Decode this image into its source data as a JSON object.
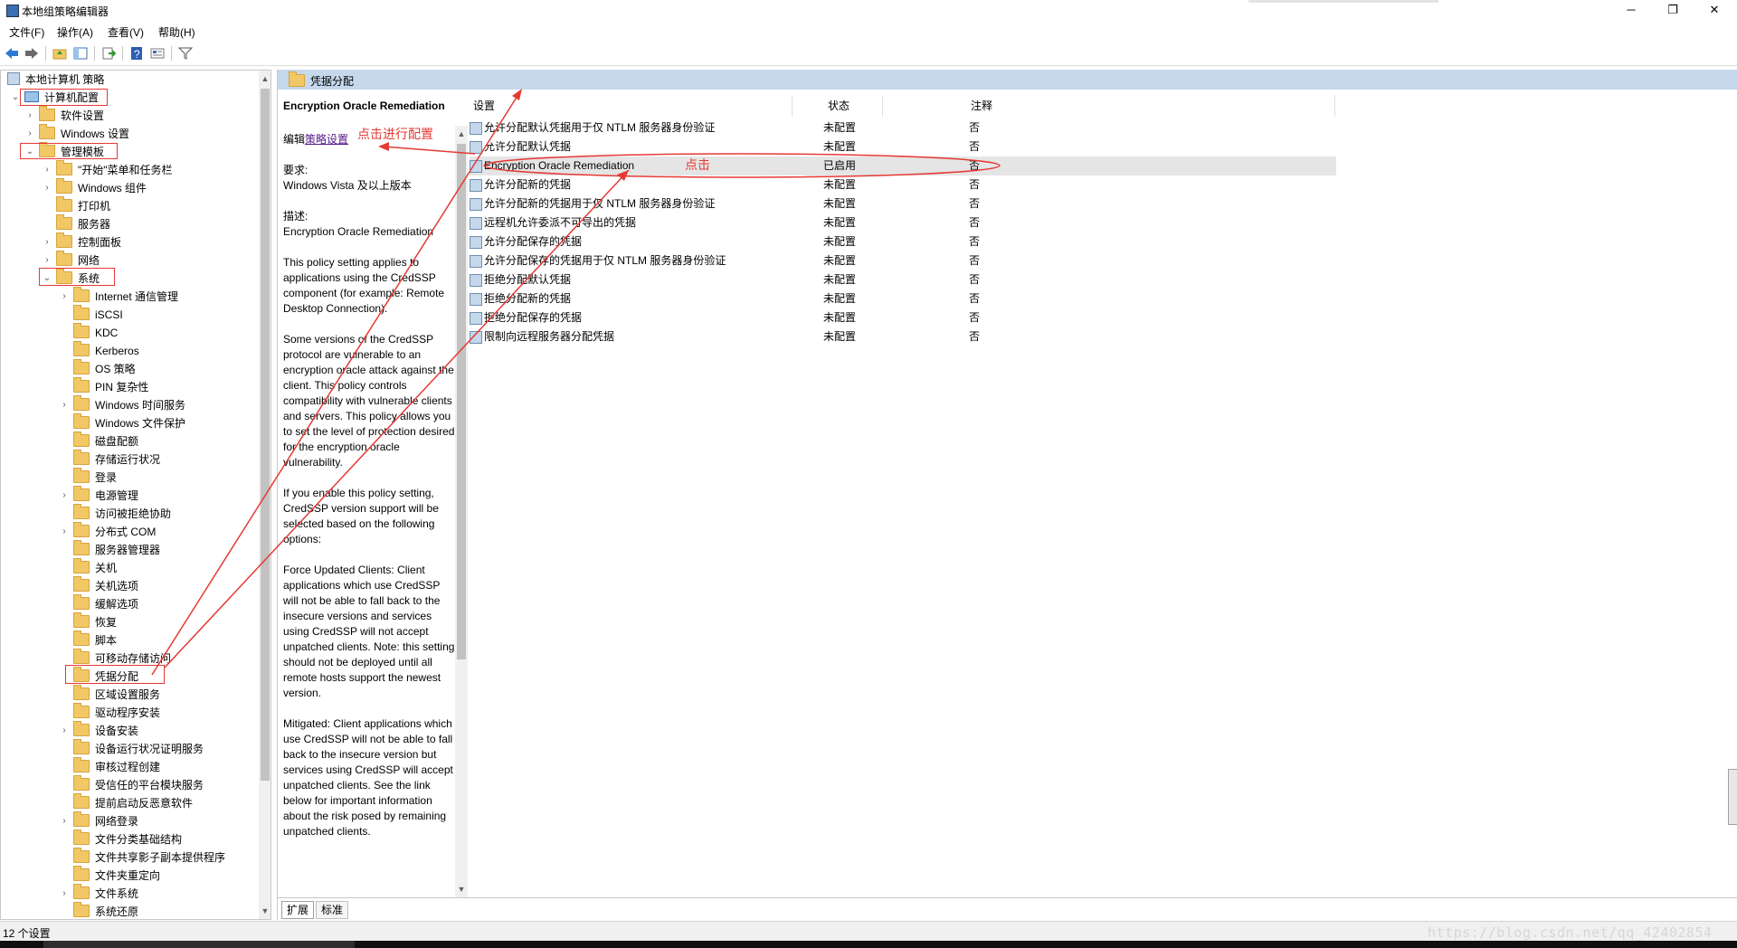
{
  "window": {
    "title": "本地组策略编辑器",
    "controls": {
      "minimize": "─",
      "maximize": "❐",
      "close": "✕"
    }
  },
  "menu": [
    "文件(F)",
    "操作(A)",
    "查看(V)",
    "帮助(H)"
  ],
  "toolbar": {
    "icons": [
      "back-arrow-icon",
      "forward-arrow-icon",
      "up-folder-icon",
      "show-hide-tree-icon",
      "export-list-icon",
      "help-icon",
      "properties-icon",
      "filter-icon"
    ]
  },
  "tree": {
    "root": "本地计算机 策略",
    "computer_config": "计算机配置",
    "software_settings": "软件设置",
    "windows_settings": "Windows 设置",
    "admin_templates": "管理模板",
    "start_menu": "\"开始\"菜单和任务栏",
    "windows_components": "Windows 组件",
    "printers": "打印机",
    "servers": "服务器",
    "control_panel": "控制面板",
    "network": "网络",
    "system": "系统",
    "system_children": [
      "Internet 通信管理",
      "iSCSI",
      "KDC",
      "Kerberos",
      "OS 策略",
      "PIN 复杂性",
      "Windows 时间服务",
      "Windows 文件保护",
      "磁盘配额",
      "存储运行状况",
      "登录",
      "电源管理",
      "访问被拒绝协助",
      "分布式 COM",
      "服务器管理器",
      "关机",
      "关机选项",
      "缓解选项",
      "恢复",
      "脚本",
      "可移动存储访问",
      "凭据分配",
      "区域设置服务",
      "驱动程序安装",
      "设备安装",
      "设备运行状况证明服务",
      "审核过程创建",
      "受信任的平台模块服务",
      "提前启动反恶意软件",
      "网络登录",
      "文件分类基础结构",
      "文件共享影子副本提供程序",
      "文件夹重定向",
      "文件系统",
      "系统还原"
    ]
  },
  "right": {
    "folder_title": "凭据分配",
    "description": {
      "title": "Encryption Oracle Remediation",
      "edit_prefix": "编辑",
      "edit_link": "策略设置",
      "requirements_label": "要求:",
      "requirements": "Windows Vista 及以上版本",
      "desc_label": "描述:",
      "desc_name": "Encryption Oracle Remediation",
      "p1": "This policy setting applies to applications using the CredSSP component (for example: Remote Desktop Connection).",
      "p2": "Some versions of the CredSSP protocol are vulnerable to an encryption oracle attack against the client.  This policy controls compatibility with vulnerable clients and servers. This policy allows you to set the level of protection desired for the encryption oracle vulnerability.",
      "p3": "If you enable this policy setting, CredSSP version support will be selected based on the following options:",
      "p4": "Force Updated Clients: Client applications which use CredSSP will not be able to fall back to the insecure versions and services using CredSSP will not accept unpatched clients. Note: this setting should not be deployed until all remote hosts support the newest version.",
      "p5": "Mitigated: Client applications which use CredSSP will not be able to fall back to the insecure version but services using CredSSP will accept unpatched clients. See the link below for important information about the risk posed by remaining unpatched clients."
    },
    "columns": {
      "setting": "设置",
      "state": "状态",
      "comment": "注释"
    },
    "rows": [
      {
        "name": "允许分配默认凭据用于仅 NTLM 服务器身份验证",
        "state": "未配置",
        "comment": "否"
      },
      {
        "name": "允许分配默认凭据",
        "state": "未配置",
        "comment": "否"
      },
      {
        "name": "Encryption Oracle Remediation",
        "state": "已启用",
        "comment": "否"
      },
      {
        "name": "允许分配新的凭据",
        "state": "未配置",
        "comment": "否"
      },
      {
        "name": "允许分配新的凭据用于仅 NTLM 服务器身份验证",
        "state": "未配置",
        "comment": "否"
      },
      {
        "name": "远程机允许委派不可导出的凭据",
        "state": "未配置",
        "comment": "否"
      },
      {
        "name": "允许分配保存的凭据",
        "state": "未配置",
        "comment": "否"
      },
      {
        "name": "允许分配保存的凭据用于仅 NTLM 服务器身份验证",
        "state": "未配置",
        "comment": "否"
      },
      {
        "name": "拒绝分配默认凭据",
        "state": "未配置",
        "comment": "否"
      },
      {
        "name": "拒绝分配新的凭据",
        "state": "未配置",
        "comment": "否"
      },
      {
        "name": "拒绝分配保存的凭据",
        "state": "未配置",
        "comment": "否"
      },
      {
        "name": "限制向远程服务器分配凭据",
        "state": "未配置",
        "comment": "否"
      }
    ],
    "tabs": [
      "扩展",
      "标准"
    ]
  },
  "status": {
    "text": "12 个设置",
    "watermark": "https://blog.csdn.net/qq_42402854"
  },
  "annotations": {
    "configure": "点击进行配置",
    "click": "点击",
    "color": "#e53935"
  }
}
